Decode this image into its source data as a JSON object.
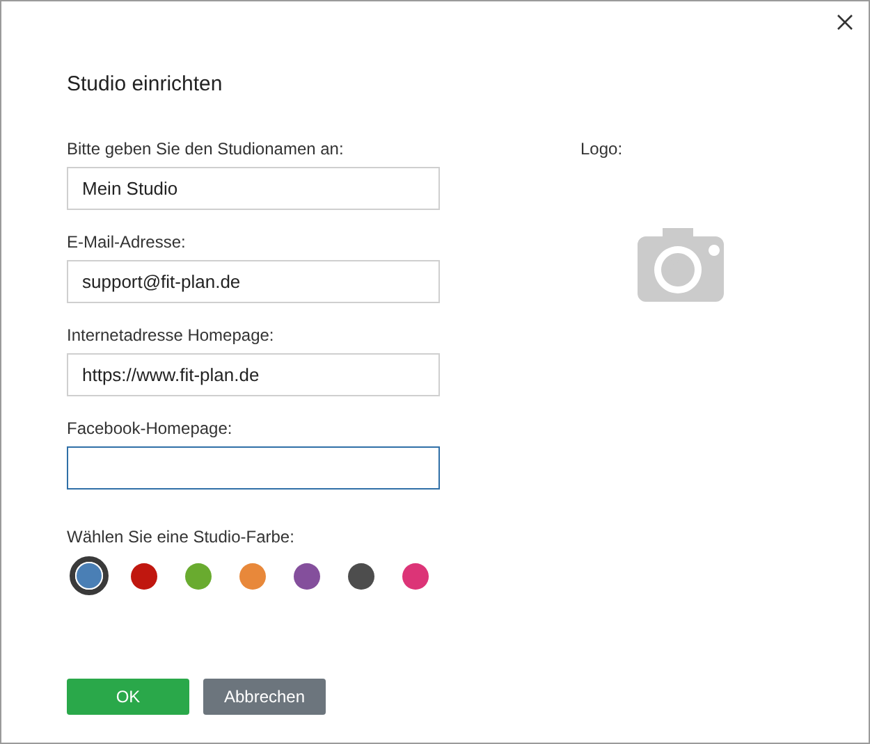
{
  "dialog": {
    "title": "Studio einrichten"
  },
  "fields": [
    {
      "label": "Bitte geben Sie den Studionamen an:",
      "value": "Mein Studio",
      "focused": false
    },
    {
      "label": "E-Mail-Adresse:",
      "value": "support@fit-plan.de",
      "focused": false
    },
    {
      "label": "Internetadresse Homepage:",
      "value": "https://www.fit-plan.de",
      "focused": false
    },
    {
      "label": "Facebook-Homepage:",
      "focused": true
    }
  ],
  "color_picker": {
    "label": "Wählen Sie eine Studio-Farbe:",
    "colors": [
      {
        "color": "#4a7fb5",
        "selected": true
      },
      {
        "color": "#c0170f",
        "selected": false
      },
      {
        "color": "#69ab2f",
        "selected": false
      },
      {
        "color": "#e8883a",
        "selected": false
      },
      {
        "color": "#844f9c",
        "selected": false
      },
      {
        "color": "#4d4d4d",
        "selected": false
      },
      {
        "color": "#dc3477",
        "selected": false
      }
    ]
  },
  "logo": {
    "label": "Logo:"
  },
  "buttons": [
    {
      "label": "OK",
      "kind": "primary"
    },
    {
      "label": "Abbrechen",
      "kind": "secondary"
    }
  ]
}
